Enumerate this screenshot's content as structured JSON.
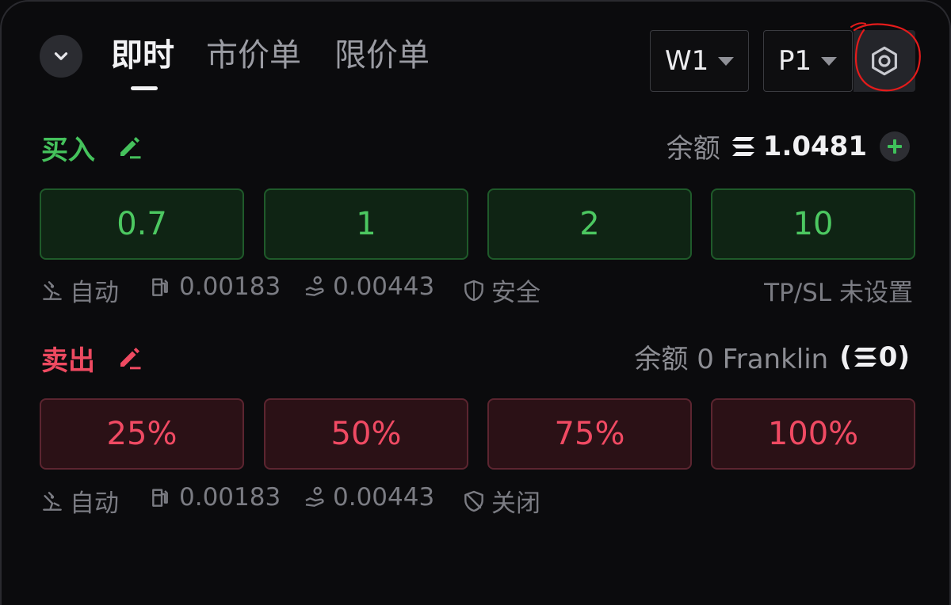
{
  "header": {
    "tabs": [
      {
        "label": "即时",
        "active": true
      },
      {
        "label": "市价单",
        "active": false
      },
      {
        "label": "限价单",
        "active": false
      }
    ],
    "wallet_selector": "W1",
    "preset_selector": "P1"
  },
  "buy": {
    "title": "买入",
    "balance_label": "余额",
    "balance_value": "1.0481",
    "amounts": [
      "0.7",
      "1",
      "2",
      "10"
    ],
    "info": {
      "mode": "自动",
      "priority_fee": "0.00183",
      "tip": "0.00443",
      "protection": "安全",
      "tpsl": "TP/SL 未设置"
    }
  },
  "sell": {
    "title": "卖出",
    "balance_text": "余额 0 Franklin",
    "balance_sol": "0",
    "amounts": [
      "25%",
      "50%",
      "75%",
      "100%"
    ],
    "info": {
      "mode": "自动",
      "priority_fee": "0.00183",
      "tip": "0.00443",
      "protection": "关闭"
    }
  },
  "colors": {
    "buy": "#45c25c",
    "sell": "#ef4a61",
    "background": "#0b0b0d"
  }
}
